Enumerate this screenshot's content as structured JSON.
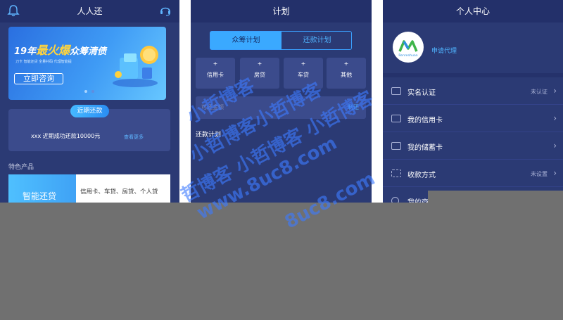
{
  "panel1": {
    "header_title": "人人还",
    "banner": {
      "title_prefix": "19年",
      "title_hot": "最火爆",
      "title_suffix": "众筹清债",
      "subtitle": "刀卡  智能还贷  全量补码  代理智能提",
      "button_label": "立即咨询"
    },
    "recent": {
      "tag": "近期还款",
      "text": "xxx 近期成功还款10000元",
      "more": "查看更多"
    },
    "section_title": "特色产品",
    "product": {
      "name": "智能还贷",
      "desc": "信用卡、车贷、房贷、个人贷"
    }
  },
  "panel2": {
    "header_title": "计划",
    "tabs": [
      "众筹计划",
      "还款计划"
    ],
    "categories": [
      "信用卡",
      "房贷",
      "车贷",
      "其他"
    ],
    "input_placeholder": "可还金额",
    "input_button": "制还",
    "plan_title": "还款计划"
  },
  "panel3": {
    "header_title": "个人中心",
    "avatar_text": "Renrenhuan",
    "apply_label": "申请代理",
    "menu": [
      {
        "label": "实名认证",
        "status": "未认证"
      },
      {
        "label": "我的信用卡",
        "status": ""
      },
      {
        "label": "我的储蓄卡",
        "status": ""
      },
      {
        "label": "收款方式",
        "status": "未设置"
      },
      {
        "label": "我的商户",
        "status": ""
      }
    ]
  },
  "watermark": {
    "line1": "小哲博客",
    "line2": "小哲博客小哲博客",
    "line3": "哲博客 小哲博客 小哲博客",
    "line4": "www.8uc8.com",
    "line5": "8uc8.com"
  },
  "colors": {
    "panel_bg": "#2b3a74",
    "accent": "#3aa9ff",
    "watermark": "#3e7bff"
  }
}
